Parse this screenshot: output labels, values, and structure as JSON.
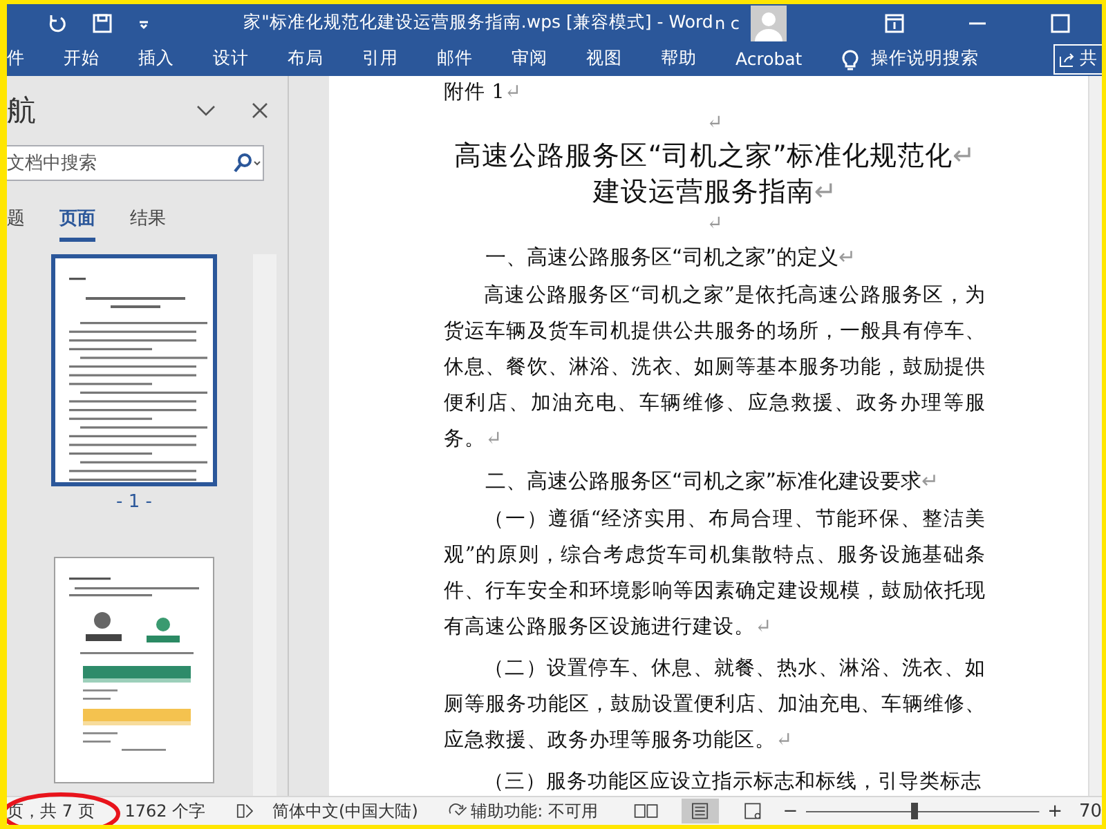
{
  "title_bar": {
    "title": "家\"标准化规范化建设运营服务指南.wps [兼容模式]  -  Word",
    "user": "n c"
  },
  "ribbon": {
    "tabs": [
      "件",
      "开始",
      "插入",
      "设计",
      "布局",
      "引用",
      "邮件",
      "审阅",
      "视图",
      "帮助",
      "Acrobat"
    ],
    "tell_me": "操作说明搜索",
    "share": "共"
  },
  "navigation": {
    "title": "航",
    "search": {
      "placeholder": "文档中搜索"
    },
    "tabs": [
      {
        "label": "题",
        "selected": false
      },
      {
        "label": "页面",
        "selected": true
      },
      {
        "label": "结果",
        "selected": false
      }
    ],
    "pages": [
      {
        "label": "- 1 -",
        "selected": true,
        "kind": "text"
      },
      {
        "selected": false,
        "kind": "logos"
      }
    ]
  },
  "document": {
    "paragraphs": [
      {
        "kind": "plain",
        "text": "附件 1",
        "end_mark": "↵"
      },
      {
        "kind": "empty",
        "end_mark": "↵"
      },
      {
        "kind": "title",
        "text": "高速公路服务区“司机之家”标准化规范化",
        "end_mark": "↵"
      },
      {
        "kind": "title",
        "text": "建设运营服务指南",
        "end_mark": "↵"
      },
      {
        "kind": "empty",
        "end_mark": "↵"
      },
      {
        "kind": "heading",
        "text": "一、高速公路服务区“司机之家”的定义",
        "end_mark": "↵"
      },
      {
        "kind": "body",
        "text": "高速公路服务区“司机之家”是依托高速公路服务区，为货运车辆及货车司机提供公共服务的场所，一般具有停车、休息、餐饮、淋浴、洗衣、如厕等基本服务功能，鼓励提供便利店、加油充电、车辆维修、应急救援、政务办理等服务。",
        "end_mark": "↵"
      },
      {
        "kind": "heading",
        "text": "二、高速公路服务区“司机之家”标准化建设要求",
        "end_mark": "↵"
      },
      {
        "kind": "body",
        "text": "（一）遵循“经济实用、布局合理、节能环保、整洁美观”的原则，综合考虑货车司机集散特点、服务设施基础条件、行车安全和环境影响等因素确定建设规模，鼓励依托现有高速公路服务区设施进行建设。",
        "end_mark": "↵"
      },
      {
        "kind": "body",
        "text": "（二）设置停车、休息、就餐、热水、淋浴、洗衣、如厕等服务功能区，鼓励设置便利店、加油充电、车辆维修、应急救援、政务办理等服务功能区。",
        "end_mark": "↵"
      },
      {
        "kind": "body",
        "text": "（三）服务功能区应设立指示标志和标线，引导类标志"
      }
    ]
  },
  "status_bar": {
    "items": [
      "页，共 7 页",
      "1762 个字",
      "简体中文(中国大陆)",
      "辅助功能: 不可用"
    ],
    "zoom": {
      "minus": "−",
      "plus": "+",
      "level": 0.45,
      "reading": "70"
    }
  },
  "annotation": {
    "kind": "ellipse"
  }
}
